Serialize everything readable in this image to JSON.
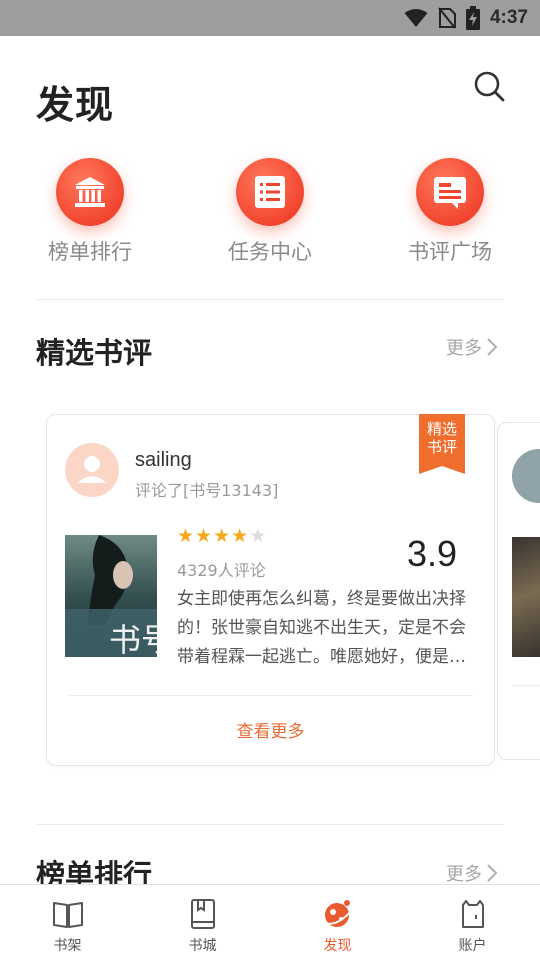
{
  "status_bar": {
    "time": "4:37"
  },
  "header": {
    "title": "发现"
  },
  "entries": [
    {
      "label": "榜单排行",
      "icon": "bank-icon"
    },
    {
      "label": "任务中心",
      "icon": "list-icon"
    },
    {
      "label": "书评广场",
      "icon": "comment-card-icon"
    }
  ],
  "featured_reviews": {
    "title": "精选书评",
    "more": "更多",
    "card": {
      "badge": "精选书评",
      "username": "sailing",
      "reviewed": "评论了[书号13143]",
      "rating_stars": 4,
      "rating_max": 5,
      "review_count": "4329人评论",
      "score": "3.9",
      "text": "女主即使再怎么纠葛，终是要做出决择的！张世豪自知逃不出生天，定是不会带着程霖一起逃亡。唯愿她好，便是晴…",
      "see_more": "查看更多",
      "cover_title": "书号"
    }
  },
  "rankings": {
    "title": "榜单排行",
    "more": "更多"
  },
  "tabbar": [
    {
      "label": "书架",
      "icon": "bookshelf-icon",
      "active": false
    },
    {
      "label": "书城",
      "icon": "book-icon",
      "active": false
    },
    {
      "label": "发现",
      "icon": "planet-icon",
      "active": true
    },
    {
      "label": "账户",
      "icon": "account-icon",
      "active": false
    }
  ],
  "colors": {
    "accent": "#f2452f",
    "badge": "#f06e2d",
    "link": "#ea6b34",
    "star": "#f7a91b"
  }
}
